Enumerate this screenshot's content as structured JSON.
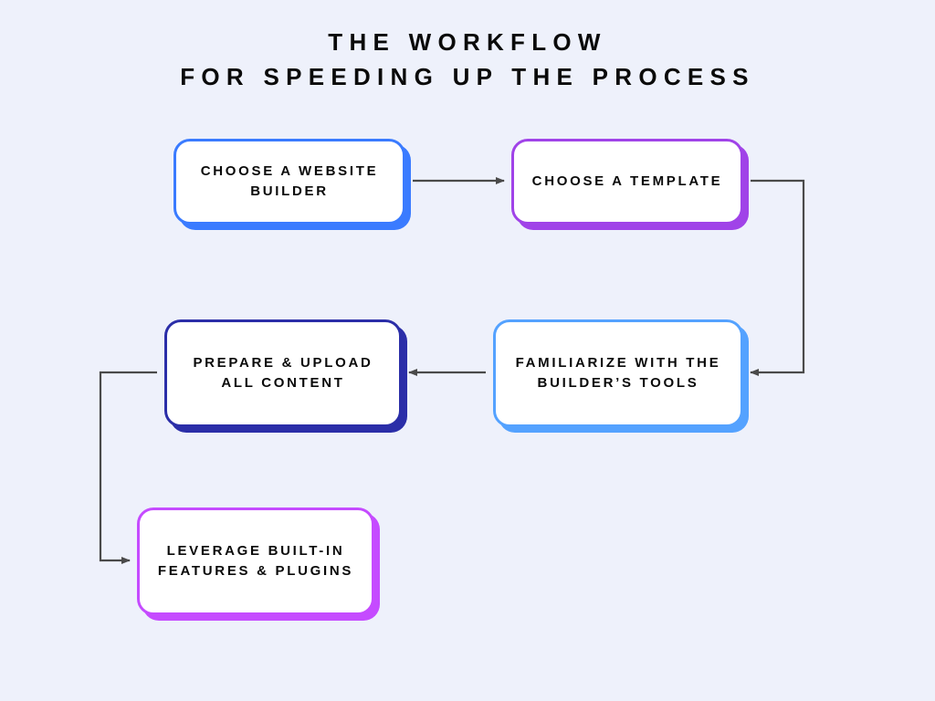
{
  "title_line1": "The workflow",
  "title_line2": "for speeding up the process",
  "steps": {
    "s1": "CHOOSE A WEBSITE BUILDER",
    "s2": "CHOOSE A TEMPLATE",
    "s3": "FAMILIARIZE WITH THE BUILDER’S TOOLS",
    "s4": "PREPARE & UPLOAD ALL CONTENT",
    "s5": "LEVERAGE BUILT-IN FEATURES & PLUGINS"
  },
  "colors": {
    "blue": "#3a7bff",
    "purple": "#a043e8",
    "sky": "#54a2ff",
    "indigo": "#2b2ea8",
    "magenta": "#c54bff",
    "arrow": "#4a4a4a",
    "bg": "#eef1fb"
  }
}
